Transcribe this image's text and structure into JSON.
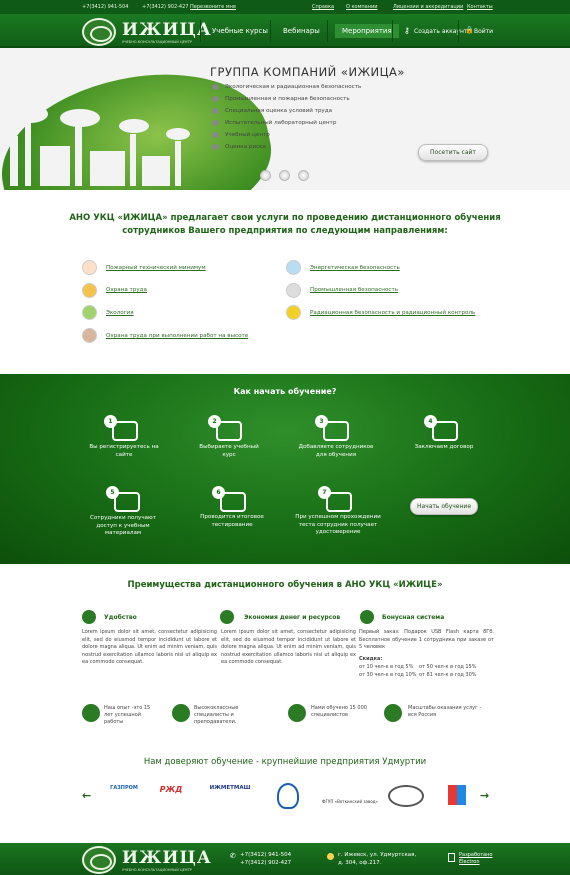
{
  "topbar": {
    "phone1": "+7(3412) 941-504",
    "phone2": "+7(3412) 902-427",
    "callback": "Перезвоните мне",
    "links": [
      "Справка",
      "О компании",
      "Лицензии и аккредитации",
      "Контакты"
    ]
  },
  "nav": {
    "logo_name": "ИЖИЦА",
    "logo_sub": "УЧЕБНО-КОНСУЛЬТАЦИОННЫЙ ЦЕНТР",
    "items": [
      "Учебные курсы",
      "Вебинары",
      "Мероприятия"
    ],
    "create_account": "Создать аккаунт",
    "login": "Войти"
  },
  "hero": {
    "title": "ГРУППА КОМПАНИЙ «ИЖИЦА»",
    "list": [
      "Экологическая и радиационная безопасность",
      "Промышленная и пожарная безопасность",
      "Специальная оценка условий труда",
      "Испытательный лабораторный центр",
      "Учебный центр",
      "Оценка риска"
    ],
    "button": "Посетить сайт"
  },
  "intro": {
    "heading1": "АНО УКЦ «ИЖИЦА» предлагает свои услуги по проведению дистанционного обучения",
    "heading2": "сотрудников Вашего предприятия по следующим направлениям:",
    "left": [
      "Пожарный технический минимум",
      "Охрана труда",
      "Экология",
      "Охрана труда при выполнении работ на высоте"
    ],
    "right": [
      "Энергетическая безопасность",
      "Промышленная безопасность",
      "Радиационная безопасность и радиационный контроль"
    ]
  },
  "steps": {
    "title": "Как начать обучение?",
    "items": [
      {
        "n": "1",
        "text": "Вы регистрируетесь на сайте"
      },
      {
        "n": "2",
        "text": "Выбираете учебный курс"
      },
      {
        "n": "3",
        "text": "Добавляете сотрудников для обучения"
      },
      {
        "n": "4",
        "text": "Заключаем договор"
      },
      {
        "n": "5",
        "text": "Сотрудники получают доступ к учебным материалам"
      },
      {
        "n": "6",
        "text": "Проводится итоговое тестирование"
      },
      {
        "n": "7",
        "text": "При успешном прохождении теста сотрудник получает удостоверение"
      }
    ],
    "button": "Начать обучение"
  },
  "advantages": {
    "title": "Преимущества дистанционного обучения в АНО УКЦ «ИЖИЦЕ»",
    "col1_title": "Удобство",
    "col1_text": "Lorem ipsum dolor sit amet, consectetur adipisicing elit, sed do eiusmod tempor incididunt ut labore et dolore magna aliqua. Ut enim ad minim veniam, quis nostrud exercitation ullamco laboris nisi ut aliquip ex ea commodo consequat.",
    "col2_title": "Экономия денег и ресурсов",
    "col2_text": "Lorem ipsum dolor sit amet, consectetur adipisicing elit, sed do eiusmod tempor incididunt ut labore et dolore magna aliqua. Ut enim ad minim veniam, quis nostrud exercitation ullamco laboris nisi ut aliquip ex ea commodo consequat.",
    "col3_title": "Бонусная система",
    "col3_text": "Первый заказ: Подарок USB Flash карта 8Гб. Бесплатное обучение 1 сотрудника при заказе от 5 человек",
    "discount_label": "Скидка:",
    "discounts": [
      "от 10 чел-к в год 5%",
      "от 50 чел-к в год 15%",
      "от 30 чел-к в год  10%",
      "от 81 чел-к в год  30%"
    ],
    "features": [
      "Наш опыт -это 15 лет успешной работы",
      "Высококлассные специалисты и преподаватели.",
      "Нами обучено 15 000 специалистов",
      "Масштабы оказания услуг - вся Россия"
    ]
  },
  "partners": {
    "title": "Нам доверяют обучение - крупнейшие предприятия Удмуртии",
    "names": [
      "ГАЗПРОМ",
      "РЖД",
      "ИЖМЕТМАШ",
      "",
      "ФГУП «Воткинский завод»",
      "",
      ""
    ]
  },
  "footer": {
    "phone1": "+7(3412) 941-504",
    "phone2": "+7(3412) 902-427",
    "address1": "г. Ижевск, ул. Удмуртская,",
    "address2": "д. 304, оф.217.",
    "dev1": "Разработано",
    "dev2": "Electron"
  }
}
